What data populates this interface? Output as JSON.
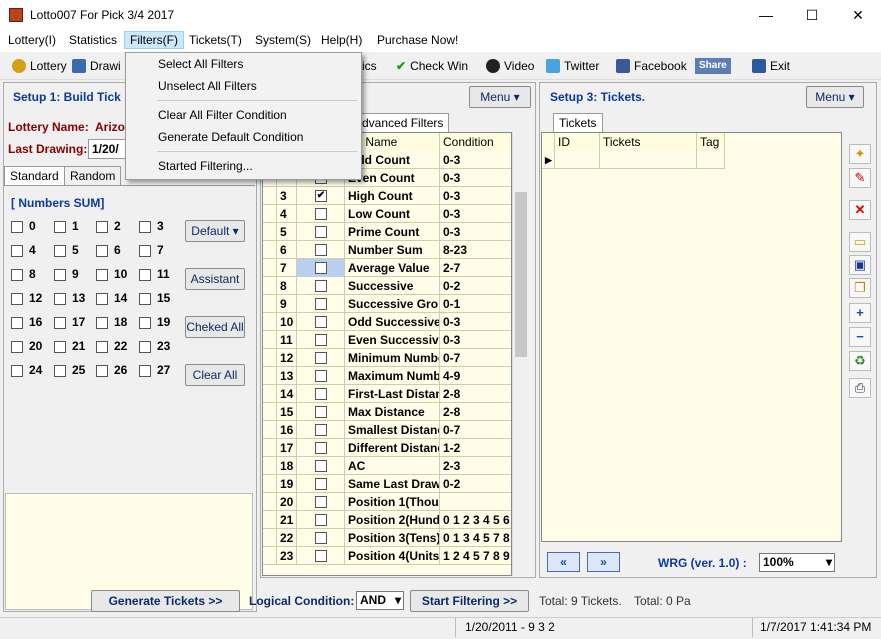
{
  "window": {
    "title": "Lotto007 For Pick 3/4 2017",
    "minimize": "—",
    "maximize": "☐",
    "close": "✕"
  },
  "menu": [
    "Lottery(I)",
    "Statistics",
    "Filters(F)",
    "Tickets(T)",
    "System(S)",
    "Help(H)",
    "Purchase  Now!"
  ],
  "toolbar": {
    "lottery": "Lottery",
    "drawing": "Drawi",
    "statistics": "atistics",
    "check_win": "Check Win",
    "video": "Video",
    "twitter": "Twitter",
    "facebook": "Facebook",
    "share": "Share",
    "exit": "Exit"
  },
  "filters_menu": {
    "select_all": "Select All Filters",
    "unselect_all": "Unselect All Filters",
    "clear_condition": "Clear All Filter Condition",
    "generate_default": "Generate Default Condition",
    "started": "Started Filtering..."
  },
  "setup1": {
    "title": "Setup 1:  Build  Tick",
    "lottery_label": "Lottery  Name:",
    "lottery_value": "Arizo",
    "last_drawing_label": "Last Drawing:",
    "last_drawing_value": "1/20/"
  },
  "left_tabs": [
    "Standard",
    "Random"
  ],
  "numbers_sum": {
    "title": "[ Numbers SUM]",
    "numbers": [
      "0",
      "1",
      "2",
      "3",
      "4",
      "5",
      "6",
      "7",
      "8",
      "9",
      "10",
      "11",
      "12",
      "13",
      "14",
      "15",
      "16",
      "17",
      "18",
      "19",
      "20",
      "21",
      "22",
      "23",
      "24",
      "25",
      "26",
      "27"
    ]
  },
  "left_buttons": {
    "default": "Default",
    "assistant": "Assistant",
    "checked_all": "Cheked All",
    "clear_all": "Clear All"
  },
  "setup2": {
    "menu": "Menu",
    "tab": "Advanced Filters",
    "col_name": "ter Name",
    "col_condition": "Condition"
  },
  "filters": [
    {
      "id": "",
      "checked": false,
      "name": "Odd Count",
      "cond": "0-3"
    },
    {
      "id": "",
      "checked": false,
      "name": "Even Count",
      "cond": "0-3"
    },
    {
      "id": "3",
      "checked": true,
      "name": "High Count",
      "cond": "0-3"
    },
    {
      "id": "4",
      "checked": false,
      "name": "Low Count",
      "cond": "0-3"
    },
    {
      "id": "5",
      "checked": false,
      "name": "Prime Count",
      "cond": "0-3"
    },
    {
      "id": "6",
      "checked": false,
      "name": "Number Sum",
      "cond": "8-23"
    },
    {
      "id": "7",
      "checked": false,
      "name": "Average Value",
      "cond": "2-7"
    },
    {
      "id": "8",
      "checked": false,
      "name": "Successive",
      "cond": "0-2"
    },
    {
      "id": "9",
      "checked": false,
      "name": "Successive Gro",
      "cond": "0-1"
    },
    {
      "id": "10",
      "checked": false,
      "name": "Odd Successive",
      "cond": "0-3"
    },
    {
      "id": "11",
      "checked": false,
      "name": "Even Successiv",
      "cond": "0-3"
    },
    {
      "id": "12",
      "checked": false,
      "name": "Minimum Numbe",
      "cond": "0-7"
    },
    {
      "id": "13",
      "checked": false,
      "name": "Maximum Numbe",
      "cond": "4-9"
    },
    {
      "id": "14",
      "checked": false,
      "name": "First-Last Distan",
      "cond": "2-8"
    },
    {
      "id": "15",
      "checked": false,
      "name": "Max Distance",
      "cond": "2-8"
    },
    {
      "id": "16",
      "checked": false,
      "name": "Smallest Distanc",
      "cond": "0-7"
    },
    {
      "id": "17",
      "checked": false,
      "name": "Different Distanc",
      "cond": "1-2"
    },
    {
      "id": "18",
      "checked": false,
      "name": "AC",
      "cond": "2-3"
    },
    {
      "id": "19",
      "checked": false,
      "name": "Same Last Draw",
      "cond": "0-2"
    },
    {
      "id": "20",
      "checked": false,
      "name": "Position 1(Thou:",
      "cond": ""
    },
    {
      "id": "21",
      "checked": false,
      "name": "Position 2(Hund",
      "cond": "0 1 2 3 4 5 6"
    },
    {
      "id": "22",
      "checked": false,
      "name": "Position 3(Tens)",
      "cond": "0 1 3 4 5 7 8"
    },
    {
      "id": "23",
      "checked": false,
      "name": "Position 4(Units",
      "cond": "1 2 4 5 7 8 9"
    }
  ],
  "setup3": {
    "title": "Setup 3:  Tickets.",
    "menu": "Menu",
    "tab": "Tickets",
    "col_id": "ID",
    "col_tickets": "Tickets",
    "col_tag": "Tag",
    "wrg": "WRG (ver. 1.0) :",
    "zoom": "100%"
  },
  "bottom": {
    "generate": "Generate Tickets >>",
    "logical_label": "Logical Condition:",
    "logical_value": "AND",
    "start_filtering": "Start Filtering  >>",
    "total_tickets": "Total: 9 Tickets.",
    "total_p": "Total: 0 Pa"
  },
  "status": {
    "draw": "1/20/2011 - 9 3 2",
    "datetime": "1/7/2017 1:41:34 PM"
  }
}
